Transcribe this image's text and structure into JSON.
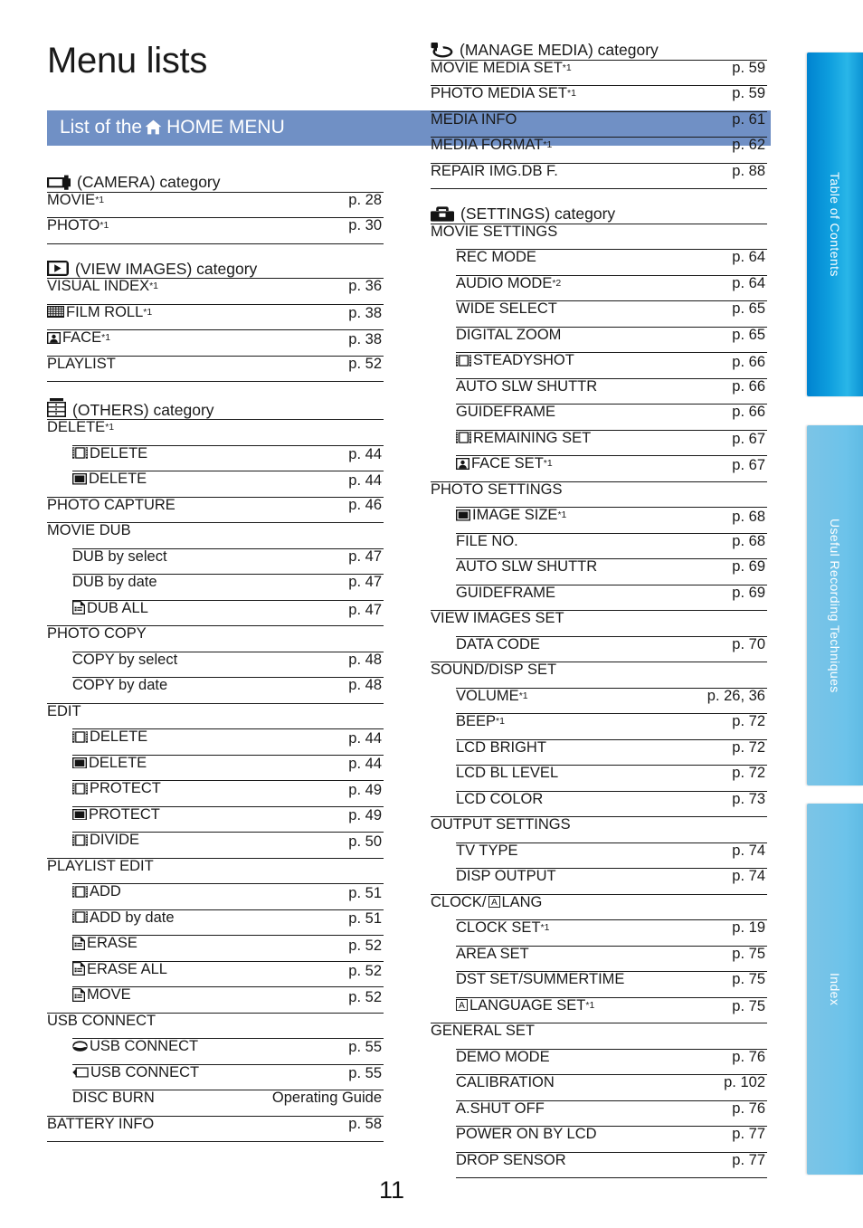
{
  "page_title": "Menu lists",
  "band": {
    "text_before": "List of the",
    "icon": "home-icon",
    "text_after": "HOME MENU"
  },
  "folio": "11",
  "colors": {
    "band": "#7090c5",
    "tab_active": "#0e9ede",
    "tab_inactive": "#74c3e8",
    "rule": "#1a1a1a"
  },
  "tabs": [
    {
      "label": "Table of Contents",
      "active": true
    },
    {
      "label": "Useful Recording Techniques",
      "active": false
    },
    {
      "label": "Index",
      "active": false
    }
  ],
  "left_column": [
    {
      "category": "(CAMERA) category",
      "icon": "camera-icon",
      "rows": [
        {
          "level": 0,
          "icon": null,
          "label": "MOVIE",
          "sup": "*1",
          "page": "p. 28"
        },
        {
          "level": 0,
          "icon": null,
          "label": "PHOTO",
          "sup": "*1",
          "page": "p. 30"
        }
      ]
    },
    {
      "category": "(VIEW IMAGES) category",
      "icon": "play-icon",
      "rows": [
        {
          "level": 0,
          "icon": null,
          "label": "VISUAL INDEX",
          "sup": "*1",
          "page": "p. 36"
        },
        {
          "level": 0,
          "icon": "film-roll-icon",
          "label": "FILM ROLL",
          "sup": "*1",
          "page": "p. 38"
        },
        {
          "level": 0,
          "icon": "face-icon",
          "label": "FACE",
          "sup": "*1",
          "page": "p. 38"
        },
        {
          "level": 0,
          "icon": null,
          "label": "PLAYLIST",
          "sup": "",
          "page": "p. 52"
        }
      ]
    },
    {
      "category": "(OTHERS) category",
      "icon": "others-icon",
      "rows": [
        {
          "level": 0,
          "icon": null,
          "label": "DELETE",
          "sup": "*1",
          "page": ""
        },
        {
          "level": 1,
          "icon": "movie-icon",
          "label": "DELETE",
          "sup": "",
          "page": "p. 44"
        },
        {
          "level": 1,
          "icon": "photo-icon",
          "label": "DELETE",
          "sup": "",
          "page": "p. 44"
        },
        {
          "level": 0,
          "icon": null,
          "label": "PHOTO CAPTURE",
          "sup": "",
          "page": "p. 46"
        },
        {
          "level": 0,
          "icon": null,
          "label": "MOVIE DUB",
          "sup": "",
          "page": ""
        },
        {
          "level": 1,
          "icon": null,
          "label": "DUB by select",
          "sup": "",
          "page": "p. 47"
        },
        {
          "level": 1,
          "icon": null,
          "label": "DUB by date",
          "sup": "",
          "page": "p. 47"
        },
        {
          "level": 1,
          "icon": "playlist-icon",
          "label": "DUB ALL",
          "sup": "",
          "page": "p. 47"
        },
        {
          "level": 0,
          "icon": null,
          "label": "PHOTO COPY",
          "sup": "",
          "page": ""
        },
        {
          "level": 1,
          "icon": null,
          "label": "COPY by select",
          "sup": "",
          "page": "p. 48"
        },
        {
          "level": 1,
          "icon": null,
          "label": "COPY by date",
          "sup": "",
          "page": "p. 48"
        },
        {
          "level": 0,
          "icon": null,
          "label": "EDIT",
          "sup": "",
          "page": ""
        },
        {
          "level": 1,
          "icon": "movie-icon",
          "label": "DELETE",
          "sup": "",
          "page": "p. 44"
        },
        {
          "level": 1,
          "icon": "photo-icon",
          "label": "DELETE",
          "sup": "",
          "page": "p. 44"
        },
        {
          "level": 1,
          "icon": "movie-icon",
          "label": "PROTECT",
          "sup": "",
          "page": "p. 49"
        },
        {
          "level": 1,
          "icon": "photo-icon",
          "label": "PROTECT",
          "sup": "",
          "page": "p. 49"
        },
        {
          "level": 1,
          "icon": "movie-icon",
          "label": "DIVIDE",
          "sup": "",
          "page": "p. 50"
        },
        {
          "level": 0,
          "icon": null,
          "label": "PLAYLIST EDIT",
          "sup": "",
          "page": ""
        },
        {
          "level": 1,
          "icon": "movie-icon",
          "label": "ADD",
          "sup": "",
          "page": "p. 51"
        },
        {
          "level": 1,
          "icon": "movie-icon",
          "label": "ADD by date",
          "sup": "",
          "page": "p. 51"
        },
        {
          "level": 1,
          "icon": "playlist-icon",
          "label": "ERASE",
          "sup": "",
          "page": "p. 52"
        },
        {
          "level": 1,
          "icon": "playlist-icon",
          "label": "ERASE ALL",
          "sup": "",
          "page": "p. 52"
        },
        {
          "level": 1,
          "icon": "playlist-icon",
          "label": "MOVE",
          "sup": "",
          "page": "p. 52"
        },
        {
          "level": 0,
          "icon": null,
          "label": "USB CONNECT",
          "sup": "",
          "page": ""
        },
        {
          "level": 1,
          "icon": "hdd-icon",
          "label": "USB CONNECT",
          "sup": "",
          "page": "p. 55"
        },
        {
          "level": 1,
          "icon": "memory-card-icon",
          "label": "USB CONNECT",
          "sup": "",
          "page": "p. 55"
        },
        {
          "level": 1,
          "icon": null,
          "label": "DISC BURN",
          "sup": "",
          "page": "Operating Guide"
        },
        {
          "level": 0,
          "icon": null,
          "label": "BATTERY INFO",
          "sup": "",
          "page": "p. 58"
        }
      ]
    }
  ],
  "right_column": [
    {
      "category": "(MANAGE MEDIA) category",
      "icon": "manage-media-icon",
      "rows": [
        {
          "level": 0,
          "icon": null,
          "label": "MOVIE MEDIA SET",
          "sup": "*1",
          "page": "p. 59"
        },
        {
          "level": 0,
          "icon": null,
          "label": "PHOTO MEDIA SET",
          "sup": "*1",
          "page": "p. 59"
        },
        {
          "level": 0,
          "icon": null,
          "label": "MEDIA INFO",
          "sup": "",
          "page": "p. 61"
        },
        {
          "level": 0,
          "icon": null,
          "label": "MEDIA FORMAT",
          "sup": "*1",
          "page": "p. 62"
        },
        {
          "level": 0,
          "icon": null,
          "label": "REPAIR IMG.DB F.",
          "sup": "",
          "page": "p. 88"
        }
      ]
    },
    {
      "category": "(SETTINGS) category",
      "icon": "toolbox-icon",
      "rows": [
        {
          "level": 0,
          "icon": null,
          "label": "MOVIE SETTINGS",
          "sup": "",
          "page": ""
        },
        {
          "level": 1,
          "icon": null,
          "label": "REC MODE",
          "sup": "",
          "page": "p. 64"
        },
        {
          "level": 1,
          "icon": null,
          "label": "AUDIO MODE",
          "sup": "*2",
          "page": "p. 64"
        },
        {
          "level": 1,
          "icon": null,
          "label": "WIDE SELECT",
          "sup": "",
          "page": "p. 65"
        },
        {
          "level": 1,
          "icon": null,
          "label": "DIGITAL ZOOM",
          "sup": "",
          "page": "p. 65"
        },
        {
          "level": 1,
          "icon": "movie-icon",
          "label": "STEADYSHOT",
          "sup": "",
          "page": "p. 66"
        },
        {
          "level": 1,
          "icon": null,
          "label": "AUTO SLW SHUTTR",
          "sup": "",
          "page": "p. 66"
        },
        {
          "level": 1,
          "icon": null,
          "label": "GUIDEFRAME",
          "sup": "",
          "page": "p. 66"
        },
        {
          "level": 1,
          "icon": "movie-icon",
          "label": "REMAINING SET",
          "sup": "",
          "page": "p. 67"
        },
        {
          "level": 1,
          "icon": "face-icon",
          "label": "FACE SET",
          "sup": "*1",
          "page": "p. 67"
        },
        {
          "level": 0,
          "icon": null,
          "label": "PHOTO SETTINGS",
          "sup": "",
          "page": ""
        },
        {
          "level": 1,
          "icon": "photo-icon",
          "label": "IMAGE SIZE",
          "sup": "*1",
          "page": "p. 68"
        },
        {
          "level": 1,
          "icon": null,
          "label": "FILE NO.",
          "sup": "",
          "page": "p. 68"
        },
        {
          "level": 1,
          "icon": null,
          "label": "AUTO SLW SHUTTR",
          "sup": "",
          "page": "p. 69"
        },
        {
          "level": 1,
          "icon": null,
          "label": "GUIDEFRAME",
          "sup": "",
          "page": "p. 69"
        },
        {
          "level": 0,
          "icon": null,
          "label": "VIEW IMAGES SET",
          "sup": "",
          "page": ""
        },
        {
          "level": 1,
          "icon": null,
          "label": "DATA CODE",
          "sup": "",
          "page": "p. 70"
        },
        {
          "level": 0,
          "icon": null,
          "label": "SOUND/DISP SET",
          "sup": "",
          "page": ""
        },
        {
          "level": 1,
          "icon": null,
          "label": "VOLUME",
          "sup": "*1",
          "page": "p. 26, 36"
        },
        {
          "level": 1,
          "icon": null,
          "label": "BEEP",
          "sup": "*1",
          "page": "p. 72"
        },
        {
          "level": 1,
          "icon": null,
          "label": "LCD BRIGHT",
          "sup": "",
          "page": "p. 72"
        },
        {
          "level": 1,
          "icon": null,
          "label": "LCD BL LEVEL",
          "sup": "",
          "page": "p. 72"
        },
        {
          "level": 1,
          "icon": null,
          "label": "LCD COLOR",
          "sup": "",
          "page": "p. 73"
        },
        {
          "level": 0,
          "icon": null,
          "label": "OUTPUT SETTINGS",
          "sup": "",
          "page": ""
        },
        {
          "level": 1,
          "icon": null,
          "label": "TV TYPE",
          "sup": "",
          "page": "p. 74"
        },
        {
          "level": 1,
          "icon": null,
          "label": "DISP OUTPUT",
          "sup": "",
          "page": "p. 74"
        },
        {
          "level": 0,
          "icon": "language-icon",
          "label": "CLOCK/",
          "label_after": "LANG",
          "sup": "",
          "page": "",
          "icon_inline": true
        },
        {
          "level": 1,
          "icon": null,
          "label": "CLOCK SET",
          "sup": "*1",
          "page": "p. 19"
        },
        {
          "level": 1,
          "icon": null,
          "label": "AREA SET",
          "sup": "",
          "page": "p. 75"
        },
        {
          "level": 1,
          "icon": null,
          "label": "DST SET/SUMMERTIME",
          "sup": "",
          "page": "p. 75"
        },
        {
          "level": 1,
          "icon": "language-icon",
          "label": "LANGUAGE SET",
          "sup": "*1",
          "page": "p. 75"
        },
        {
          "level": 0,
          "icon": null,
          "label": "GENERAL SET",
          "sup": "",
          "page": ""
        },
        {
          "level": 1,
          "icon": null,
          "label": "DEMO MODE",
          "sup": "",
          "page": "p. 76"
        },
        {
          "level": 1,
          "icon": null,
          "label": "CALIBRATION",
          "sup": "",
          "page": "p. 102"
        },
        {
          "level": 1,
          "icon": null,
          "label": "A.SHUT OFF",
          "sup": "",
          "page": "p. 76"
        },
        {
          "level": 1,
          "icon": null,
          "label": "POWER ON BY LCD",
          "sup": "",
          "page": "p. 77"
        },
        {
          "level": 1,
          "icon": null,
          "label": "DROP SENSOR",
          "sup": "",
          "page": "p. 77"
        }
      ]
    }
  ]
}
